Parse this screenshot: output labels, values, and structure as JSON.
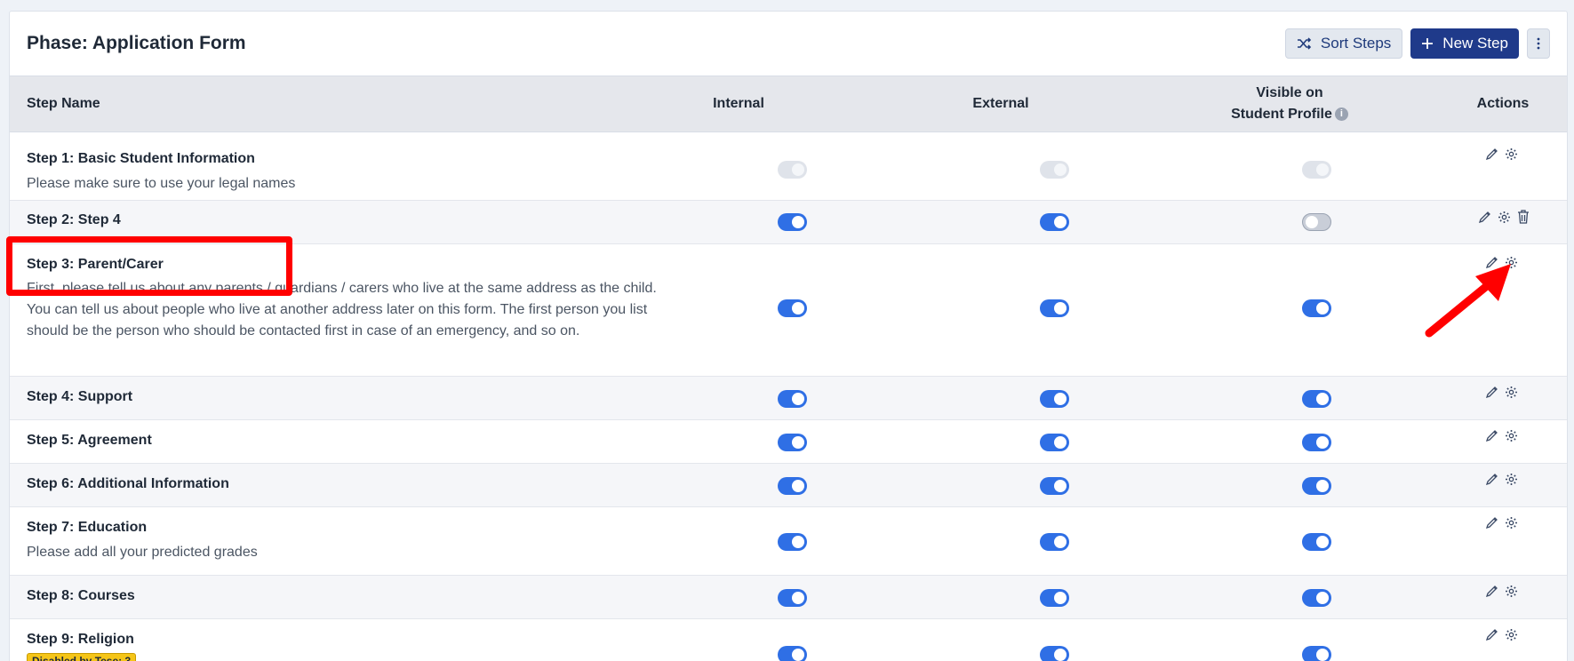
{
  "header": {
    "title": "Phase: Application Form",
    "sort_label": "Sort Steps",
    "new_label": "New Step"
  },
  "table": {
    "columns": {
      "name": "Step Name",
      "internal": "Internal",
      "external": "External",
      "visible_line1": "Visible on",
      "visible_line2": "Student Profile",
      "actions": "Actions"
    },
    "rows": [
      {
        "name": "Step 1: Basic Student Information",
        "desc": "Please make sure to use your legal names",
        "internal": "disabled",
        "external": "disabled",
        "visible": "disabled",
        "delete": false
      },
      {
        "name": "Step 2: Step 4",
        "desc": "",
        "internal": "on",
        "external": "on",
        "visible": "off",
        "delete": true
      },
      {
        "name": "Step 3: Parent/Carer",
        "desc": "First, please tell us about any parents / guardians / carers who live at the same address as the child. You can tell us about people who live at another address later on this form. The first person you list should be the person who should be contacted first in case of an emergency, and so on.",
        "internal": "on",
        "external": "on",
        "visible": "on",
        "delete": false
      },
      {
        "name": "Step 4: Support",
        "desc": "",
        "internal": "on",
        "external": "on",
        "visible": "on",
        "delete": false
      },
      {
        "name": "Step 5: Agreement",
        "desc": "",
        "internal": "on",
        "external": "on",
        "visible": "on",
        "delete": false
      },
      {
        "name": "Step 6: Additional Information",
        "desc": "",
        "internal": "on",
        "external": "on",
        "visible": "on",
        "delete": false
      },
      {
        "name": "Step 7: Education",
        "desc": "Please add all your predicted grades",
        "internal": "on",
        "external": "on",
        "visible": "on",
        "delete": false
      },
      {
        "name": "Step 8: Courses",
        "desc": "",
        "internal": "on",
        "external": "on",
        "visible": "on",
        "delete": false
      },
      {
        "name": "Step 9: Religion",
        "desc": "",
        "badge": "Disabled by Tese: 3",
        "internal": "on",
        "external": "on",
        "visible": "on",
        "delete": false
      }
    ]
  },
  "icons": {
    "sort": "shuffle-icon",
    "new": "plus-icon",
    "more": "vertical-dots-icon",
    "edit": "pencil-icon",
    "settings": "gear-icon",
    "delete": "trash-icon",
    "info": "info-icon"
  },
  "colors": {
    "primary": "#1f3a8a",
    "toggle_on": "#2f6fe5",
    "highlight": "#ff0000",
    "badge": "#f5c518"
  }
}
